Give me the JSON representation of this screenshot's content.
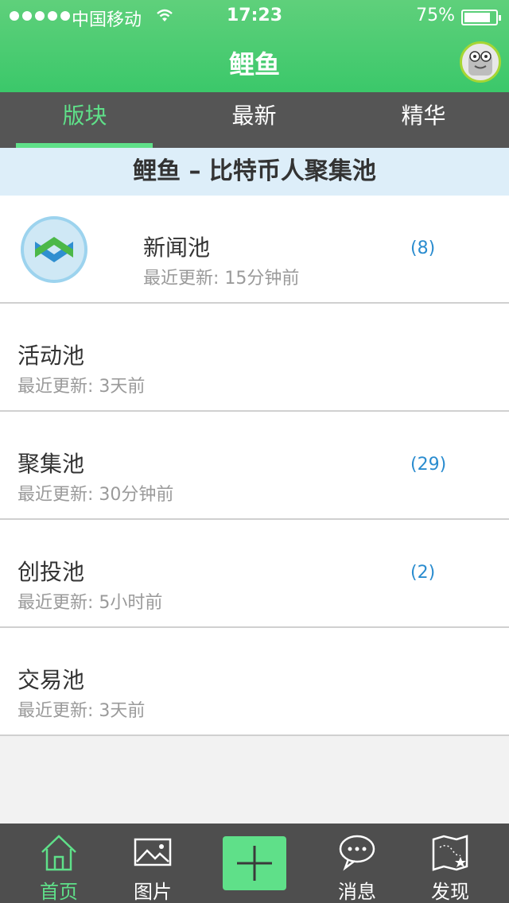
{
  "status_bar": {
    "carrier": "中国移动",
    "time": "17:23",
    "battery": "75%"
  },
  "header": {
    "title": "鲤鱼"
  },
  "tabs": [
    {
      "label": "版块",
      "active": true
    },
    {
      "label": "最新",
      "active": false
    },
    {
      "label": "精华",
      "active": false
    }
  ],
  "banner": "鲤鱼 – 比特币人聚集池",
  "list": [
    {
      "name": "新闻池",
      "updated": "最近更新: 15分钟前",
      "count": "(8)"
    },
    {
      "name": "活动池",
      "updated": "最近更新: 3天前",
      "count": ""
    },
    {
      "name": "聚集池",
      "updated": "最近更新: 30分钟前",
      "count": "(29)"
    },
    {
      "name": "创投池",
      "updated": "最近更新: 5小时前",
      "count": "(2)"
    },
    {
      "name": "交易池",
      "updated": "最近更新: 3天前",
      "count": ""
    }
  ],
  "bottom_nav": [
    {
      "label": "首页",
      "icon": "home-icon",
      "active": true
    },
    {
      "label": "图片",
      "icon": "image-icon",
      "active": false
    },
    {
      "label": "",
      "icon": "plus-icon",
      "active": false
    },
    {
      "label": "消息",
      "icon": "chat-bubble-icon",
      "active": false
    },
    {
      "label": "发现",
      "icon": "map-icon",
      "active": false
    }
  ],
  "colors": {
    "header_green": "#3bc86a",
    "accent_green": "#5fe089",
    "tab_bg": "#555555",
    "count_blue": "#2a8ccf",
    "banner_bg": "#ddeef9"
  }
}
